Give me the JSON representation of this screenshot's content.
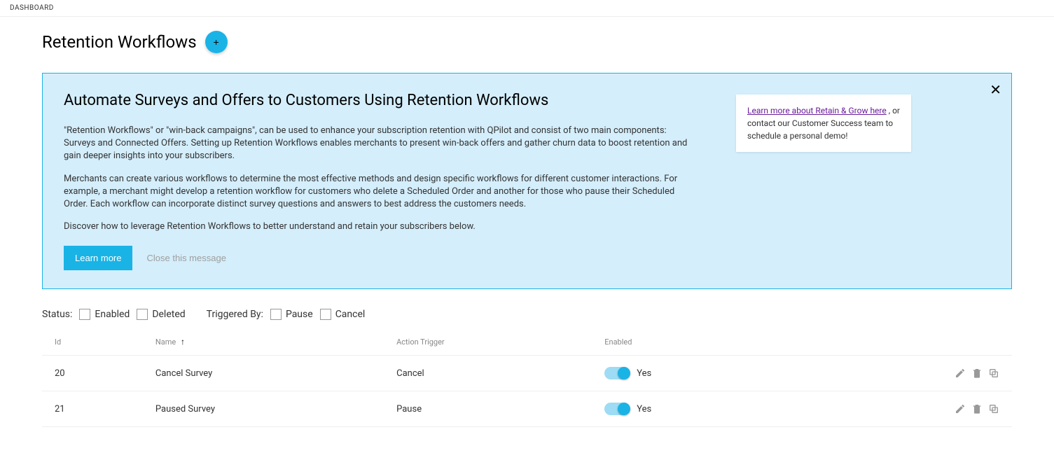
{
  "breadcrumb": "DASHBOARD",
  "page": {
    "title": "Retention Workflows",
    "add_plus": "+"
  },
  "info": {
    "title": "Automate Surveys and Offers to Customers Using Retention Workflows",
    "p1": "\"Retention Workflows\" or \"win-back campaigns\", can be used to enhance your subscription retention with QPilot and consist of two main components: Surveys and Connected Offers. Setting up Retention Workflows enables merchants to present win-back offers and gather churn data to boost retention and gain deeper insights into your subscribers.",
    "p2": "Merchants can create various workflows to determine the most effective methods and design specific workflows for different customer interactions. For example, a merchant might develop a retention workflow for customers who delete a Scheduled Order and another for those who pause their Scheduled Order. Each workflow can incorporate distinct survey questions and answers to best address the customers needs.",
    "p3": "Discover how to leverage Retention Workflows to better understand and retain your subscribers below.",
    "learn_more": "Learn more",
    "close_this": "Close this message",
    "side_link": "Learn more about Retain & Grow here",
    "side_rest": " , or contact our Customer Success team to schedule a personal demo!",
    "close_x": "✕"
  },
  "filters": {
    "status_label": "Status:",
    "enabled": "Enabled",
    "deleted": "Deleted",
    "triggered_label": "Triggered By:",
    "pause": "Pause",
    "cancel": "Cancel"
  },
  "table": {
    "headers": {
      "id": "Id",
      "name": "Name",
      "action_trigger": "Action Trigger",
      "enabled": "Enabled"
    },
    "sort_arrow": "↑",
    "rows": [
      {
        "id": "20",
        "name": "Cancel Survey",
        "trigger": "Cancel",
        "enabled_text": "Yes"
      },
      {
        "id": "21",
        "name": "Paused Survey",
        "trigger": "Pause",
        "enabled_text": "Yes"
      }
    ]
  }
}
